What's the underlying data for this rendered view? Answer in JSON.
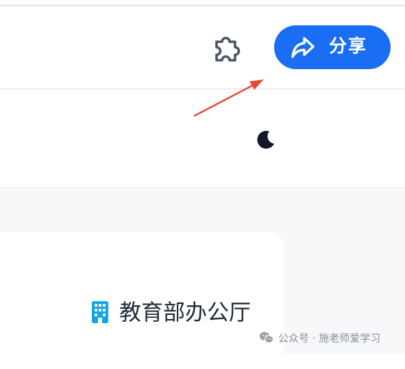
{
  "toolbar": {
    "extension_icon": "puzzle-piece-icon",
    "share_button": {
      "label": "分享",
      "icon": "share-arrow-icon",
      "color": "#1a6ef3"
    }
  },
  "header": {
    "theme_toggle_icon": "moon-icon"
  },
  "annotation": {
    "type": "red-arrow",
    "color": "#e8473b",
    "points_to": "share-button"
  },
  "card": {
    "department": {
      "icon": "building-icon",
      "icon_color": "#0ea5e9",
      "label": "教育部办公厅"
    }
  },
  "watermark": {
    "text": "公众号 · 施老师爱学习",
    "icon": "wechat-icon"
  }
}
